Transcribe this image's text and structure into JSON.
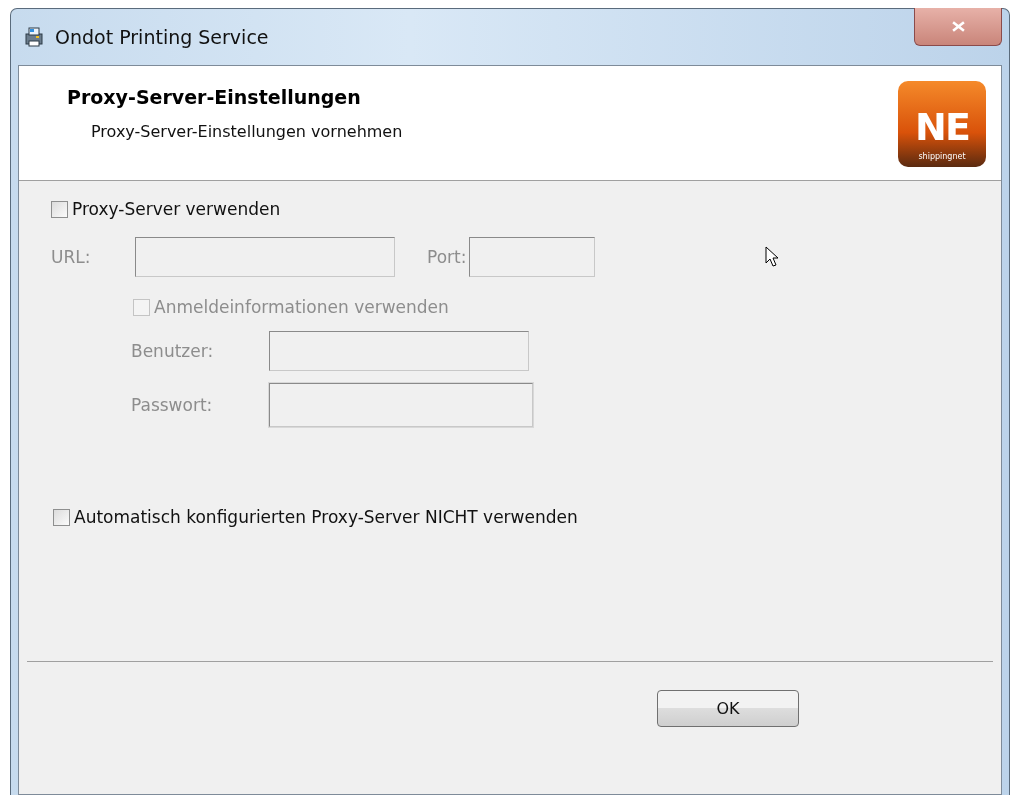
{
  "window": {
    "title": "Ondot Printing Service"
  },
  "header": {
    "title": "Proxy-Server-Einstellungen",
    "subtitle": "Proxy-Server-Einstellungen vornehmen",
    "logo": {
      "mark": "NE",
      "caption": "shippingnet"
    }
  },
  "use_proxy": {
    "label": "Proxy-Server verwenden",
    "checked": false,
    "disabled": false
  },
  "url": {
    "label": "URL:",
    "disabled": true
  },
  "port": {
    "label": "Port:",
    "disabled": true
  },
  "use_credentials": {
    "label": "Anmeldeinformationen verwenden",
    "checked": false,
    "disabled": true
  },
  "user": {
    "label": "Benutzer:",
    "disabled": true
  },
  "password": {
    "label": "Passwort:",
    "disabled": true
  },
  "no_auto_proxy": {
    "label": "Automatisch konfigurierten Proxy-Server NICHT verwenden",
    "checked": false,
    "disabled": false
  },
  "buttons": [
    {
      "label": "OK"
    }
  ]
}
